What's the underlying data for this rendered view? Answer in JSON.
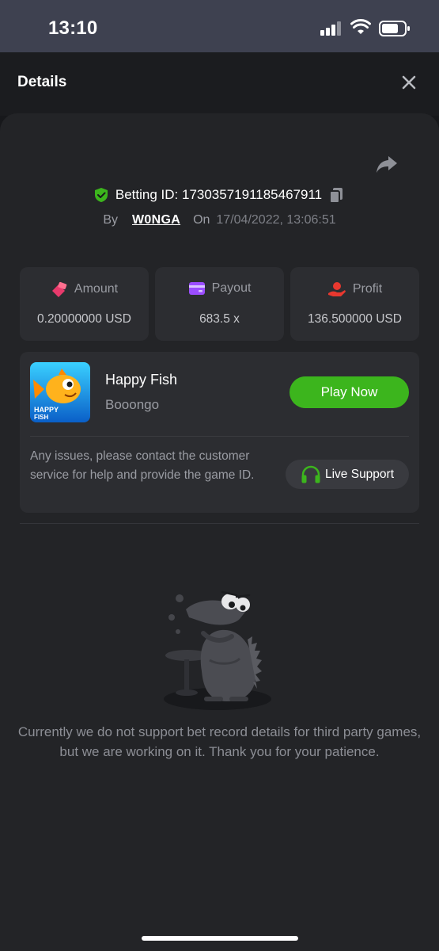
{
  "status_bar": {
    "time": "13:10"
  },
  "header": {
    "title": "Details"
  },
  "bet": {
    "betting_id_label": "Betting ID: 1730357191185467911",
    "by_label": "By",
    "username": "W0NGA",
    "on_label": "On",
    "datetime": "17/04/2022, 13:06:51"
  },
  "stats": {
    "amount": {
      "label": "Amount",
      "value": "0.20000000 USD",
      "icon": "money-icon",
      "color": "#e83a6c"
    },
    "payout": {
      "label": "Payout",
      "value": "683.5 x",
      "icon": "wallet-card-icon",
      "color": "#9b4dff"
    },
    "profit": {
      "label": "Profit",
      "value": "136.500000 USD",
      "icon": "hand-coin-icon",
      "color": "#e8382f"
    }
  },
  "game": {
    "name": "Happy Fish",
    "provider": "Booongo",
    "thumb_text": "HAPPY FISH",
    "play_label": "Play Now",
    "issue_text": "Any issues, please contact the customer service for help and provide the game ID.",
    "support_label": "Live Support"
  },
  "notice": "Currently we do not support bet record details for third party games, but we are working on it. Thank you for your patience.",
  "colors": {
    "accent_green": "#3cb51d",
    "background": "#17181b",
    "card": "#2c2d31"
  }
}
